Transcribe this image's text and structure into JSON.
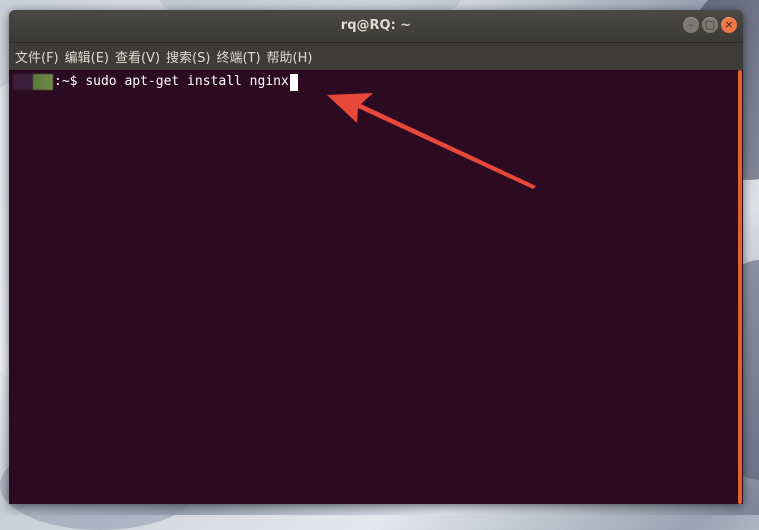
{
  "window": {
    "title": "rq@RQ: ~",
    "controls": [
      {
        "name": "minimize",
        "glyph": "–"
      },
      {
        "name": "maximize",
        "glyph": "□"
      },
      {
        "name": "close",
        "glyph": "×"
      }
    ]
  },
  "menubar": {
    "items": [
      {
        "label": "文件(F)"
      },
      {
        "label": "编辑(E)"
      },
      {
        "label": "查看(V)"
      },
      {
        "label": "搜索(S)"
      },
      {
        "label": "终端(T)"
      },
      {
        "label": "帮助(H)"
      }
    ]
  },
  "terminal": {
    "prompt_suffix": ":~$ ",
    "command": "sudo apt-get install nginx",
    "background_color": "#2c0a22",
    "text_color": "#ffffff"
  },
  "annotation": {
    "arrow_color": "#e8483a",
    "icon": "red-arrow-icon"
  }
}
